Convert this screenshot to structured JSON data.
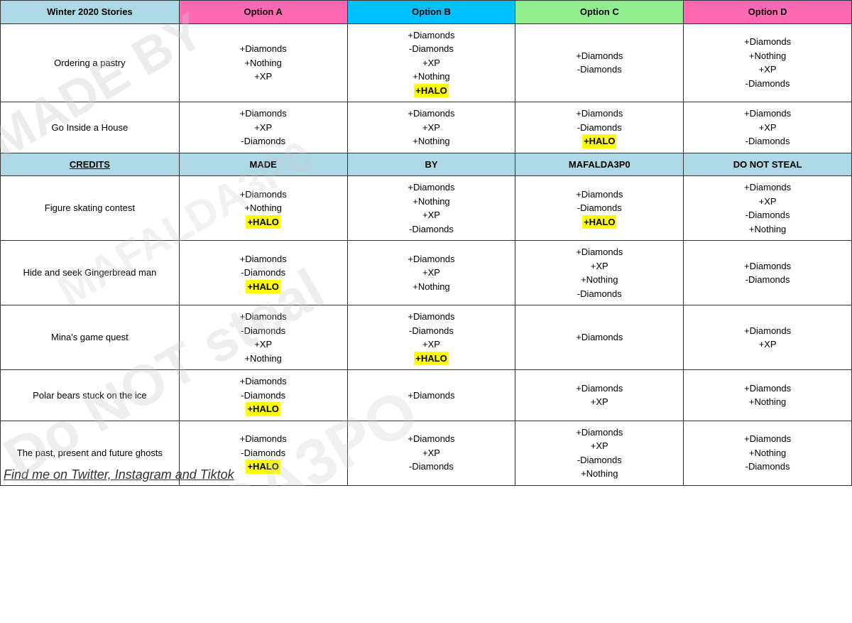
{
  "headers": {
    "story": "Winter 2020 Stories",
    "a": "Option A",
    "b": "Option B",
    "c": "Option C",
    "d": "Option D"
  },
  "credits": {
    "story": "CREDITS",
    "a": "MADE",
    "b": "BY",
    "c": "MAFALDA3P0",
    "d": "DO NOT STEAL"
  },
  "rows": [
    {
      "story": "Ordering a pastry",
      "a": [
        "+Diamonds",
        "+Nothing",
        "+XP"
      ],
      "b": [
        "+Diamonds",
        "-Diamonds",
        "+XP",
        "+Nothing",
        "+HALO"
      ],
      "b_halo": [
        4
      ],
      "c": [
        "+Diamonds",
        "-Diamonds"
      ],
      "d": [
        "+Diamonds",
        "+Nothing",
        "+XP",
        "-Diamonds"
      ]
    },
    {
      "story": "Go Inside a House",
      "a": [
        "+Diamonds",
        "+XP",
        "-Diamonds"
      ],
      "b": [
        "+Diamonds",
        "+XP",
        "+Nothing"
      ],
      "c": [
        "+Diamonds",
        "-Diamonds",
        "+HALO"
      ],
      "c_halo": [
        2
      ],
      "d": [
        "+Diamonds",
        "+XP",
        "-Diamonds"
      ]
    },
    {
      "story": "Figure skating contest",
      "a": [
        "+Diamonds",
        "+Nothing",
        "+HALO"
      ],
      "a_halo": [
        2
      ],
      "b": [
        "+Diamonds",
        "+Nothing",
        "+XP",
        "-Diamonds"
      ],
      "c": [
        "+Diamonds",
        "-Diamonds",
        "+HALO"
      ],
      "c_halo": [
        2
      ],
      "d": [
        "+Diamonds",
        "+XP",
        "-Diamonds",
        "+Nothing"
      ]
    },
    {
      "story": "Hide and seek Gingerbread man",
      "a": [
        "+Diamonds",
        "-Diamonds",
        "+HALO"
      ],
      "a_halo": [
        2
      ],
      "b": [
        "+Diamonds",
        "+XP",
        "+Nothing"
      ],
      "c": [
        "+Diamonds",
        "+XP",
        "+Nothing",
        "-Diamonds"
      ],
      "d": [
        "+Diamonds",
        "-Diamonds"
      ]
    },
    {
      "story": "Mina's game quest",
      "a": [
        "+Diamonds",
        "-Diamonds",
        "+XP",
        "+Nothing"
      ],
      "b": [
        "+Diamonds",
        "-Diamonds",
        "+XP",
        "+HALO"
      ],
      "b_halo": [
        3
      ],
      "c": [
        "+Diamonds"
      ],
      "d": [
        "+Diamonds",
        "+XP"
      ]
    },
    {
      "story": "Polar bears stuck on the ice",
      "a": [
        "+Diamonds",
        "-Diamonds",
        "+HALO"
      ],
      "a_halo": [
        2
      ],
      "b": [
        "+Diamonds"
      ],
      "c": [
        "+Diamonds",
        "+XP"
      ],
      "d": [
        "+Diamonds",
        "+Nothing"
      ]
    },
    {
      "story": "The past, present and future ghosts",
      "a": [
        "+Diamonds",
        "-Diamonds",
        "+HALO"
      ],
      "a_halo": [
        2
      ],
      "b": [
        "+Diamonds",
        "+XP",
        "-Diamonds"
      ],
      "c": [
        "+Diamonds",
        "+XP",
        "-Diamonds",
        "+Nothing"
      ],
      "d": [
        "+Diamonds",
        "+Nothing",
        "-Diamonds"
      ]
    }
  ],
  "bottom_text": "Find me on Twitter, Instagram and Tiktok"
}
